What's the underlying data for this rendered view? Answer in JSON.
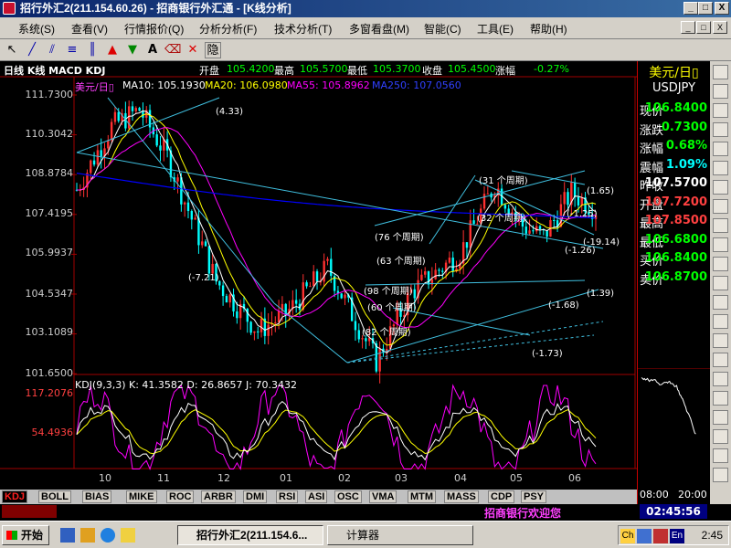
{
  "window": {
    "title": "招行外汇2(211.154.60.26) - 招商银行外汇通 - [K线分析]",
    "buttons": [
      "_",
      "□",
      "X"
    ]
  },
  "menu": {
    "items": [
      "系统(S)",
      "查看(V)",
      "行情报价(Q)",
      "分析分析(F)",
      "技术分析(T)",
      "多窗看盘(M)",
      "智能(C)",
      "工具(E)",
      "帮助(H)"
    ],
    "mdi_buttons": [
      "_",
      "□",
      "X"
    ]
  },
  "toolbar": {
    "tools": [
      "cursor-icon",
      "line-icon",
      "parallel-icon",
      "fib-icon",
      "cycle-icon",
      "up-arrow-icon",
      "down-arrow-icon",
      "text-icon",
      "eraser-icon",
      "delete-icon",
      "hide-icon"
    ],
    "glyphs": [
      "↖",
      "╱",
      "⫽",
      "≡",
      "║",
      "▲",
      "▼",
      "A",
      "⌫",
      "✕",
      "隐"
    ]
  },
  "chart": {
    "header": {
      "name": "日线 K线 MACD KDJ",
      "open_label": "开盘",
      "open": "105.4200",
      "high_label": "最高",
      "high": "105.5700",
      "low_label": "最低",
      "low": "105.3700",
      "close_label": "收盘",
      "close": "105.4500",
      "change_label": "涨幅",
      "change": "-0.27%"
    },
    "ma": {
      "title": "美元/日▯",
      "ma10": "MA10: 105.1930",
      "ma20": "MA20: 106.0980",
      "ma55": "MA55: 105.8962",
      "ma250": "MA250: 107.0560"
    },
    "price_axis": [
      "111.7300",
      "110.3042",
      "108.8784",
      "107.4195",
      "105.9937",
      "104.5347",
      "103.1089",
      "101.6500"
    ],
    "kdj_info": "KDJ(9,3,3) K: 41.3582  D: 26.8657  J: 70.3432",
    "kdj_axis": [
      "117.2076",
      "54.4936"
    ],
    "months": [
      "10",
      "11",
      "12",
      "01",
      "02",
      "03",
      "04",
      "05",
      "06"
    ],
    "annotations": [
      "(4.33)",
      "(-7.21)",
      "(31 个周期)",
      "(32 个周期)",
      "(76 个周期)",
      "(63 个周期)",
      "(98 个周期)",
      "(60 个周期)",
      "(82 个周期)",
      "(1.65)",
      "(-1.25)",
      "(-19.14)",
      "(-1.26)",
      "(1.39)",
      "(-1.68)",
      "(-1.73)"
    ],
    "colors": {
      "up": "#ff3030",
      "down": "#00ffff",
      "ma10": "#ffffff",
      "ma20": "#ffff00",
      "ma55": "#ff00ff",
      "ma250": "#0000ff",
      "trend": "#40c0e0"
    }
  },
  "quote": {
    "pair_cn": "美元/日▯",
    "pair": "USDJPY",
    "rows": [
      {
        "label": "现价",
        "value": "106.8400",
        "color": "#00ff00"
      },
      {
        "label": "涨跌",
        "value": "0.7300",
        "color": "#00ff00"
      },
      {
        "label": "涨幅",
        "value": "0.68%",
        "color": "#00ff00"
      },
      {
        "label": "震幅",
        "value": "1.09%",
        "color": "#00ffff"
      },
      {
        "label": "昨收",
        "value": "107.5700",
        "color": "#ffffff"
      },
      {
        "label": "开盘",
        "value": "107.7200",
        "color": "#ff4040"
      },
      {
        "label": "最高",
        "value": "107.8500",
        "color": "#ff4040"
      },
      {
        "label": "最低",
        "value": "106.6800",
        "color": "#00ff00"
      },
      {
        "label": "买价",
        "value": "106.8400",
        "color": "#00ff00"
      },
      {
        "label": "卖价",
        "value": "106.8700",
        "color": "#00ff00"
      }
    ],
    "intraday_times": [
      "08:00",
      "20:00"
    ]
  },
  "tabs": [
    "KDJ",
    "BOLL",
    "BIAS",
    "MIKE",
    "ROC",
    "ARBR",
    "DMI",
    "RSI",
    "ASI",
    "OSC",
    "VMA",
    "MTM",
    "MASS",
    "CDP",
    "PSY"
  ],
  "status": {
    "welcome": "招商银行欢迎您",
    "clock": "02:45:56"
  },
  "taskbar": {
    "start": "开始",
    "tasks": [
      "招行外汇2(211.154.6...",
      "计算器"
    ],
    "tray_time": "2:45",
    "tray_icons": [
      "ch-icon",
      "ie-icon",
      "sound-icon",
      "lang-icon"
    ],
    "tray_labels": [
      "Ch",
      "",
      "",
      "En"
    ]
  }
}
